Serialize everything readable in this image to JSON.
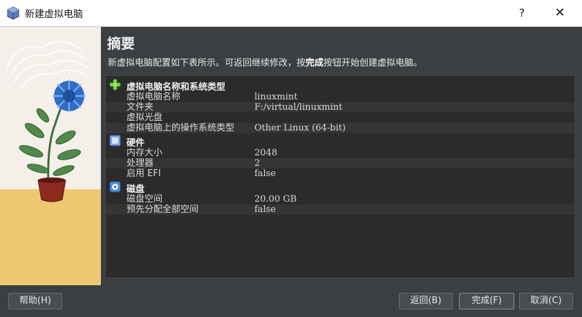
{
  "window": {
    "title": "新建虚拟电脑",
    "help_glyph": "?",
    "close_glyph": "✕"
  },
  "main": {
    "heading": "摘要",
    "description_before": "新虚拟电脑配置如下表所示。可返回继续修改，按",
    "description_bold": "完成",
    "description_after": "按钮开始创建虚拟电脑。"
  },
  "summary": {
    "sections": [
      {
        "title": "虚拟电脑名称和系统类型",
        "icon": "puzzle-icon",
        "rows": [
          {
            "key": "虚拟电脑名称",
            "value": "linuxmint"
          },
          {
            "key": "文件夹",
            "value": "F:/virtual/linuxmint"
          },
          {
            "key": "虚拟光盘",
            "value": ""
          },
          {
            "key": "虚拟电脑上的操作系统类型",
            "value": "Other Linux (64-bit)"
          }
        ]
      },
      {
        "title": "硬件",
        "icon": "chip-icon",
        "rows": [
          {
            "key": "内存大小",
            "value": "2048"
          },
          {
            "key": "处理器",
            "value": "2"
          },
          {
            "key": "启用 EFI",
            "value": "false"
          }
        ]
      },
      {
        "title": "磁盘",
        "icon": "disk-icon",
        "rows": [
          {
            "key": "磁盘空间",
            "value": "20.00 GB"
          },
          {
            "key": "预先分配全部空间",
            "value": "false"
          }
        ]
      }
    ]
  },
  "footer": {
    "help_label": "帮助(H)",
    "back_label": "返回(B)",
    "finish_label": "完成(F)",
    "cancel_label": "取消(C)"
  }
}
